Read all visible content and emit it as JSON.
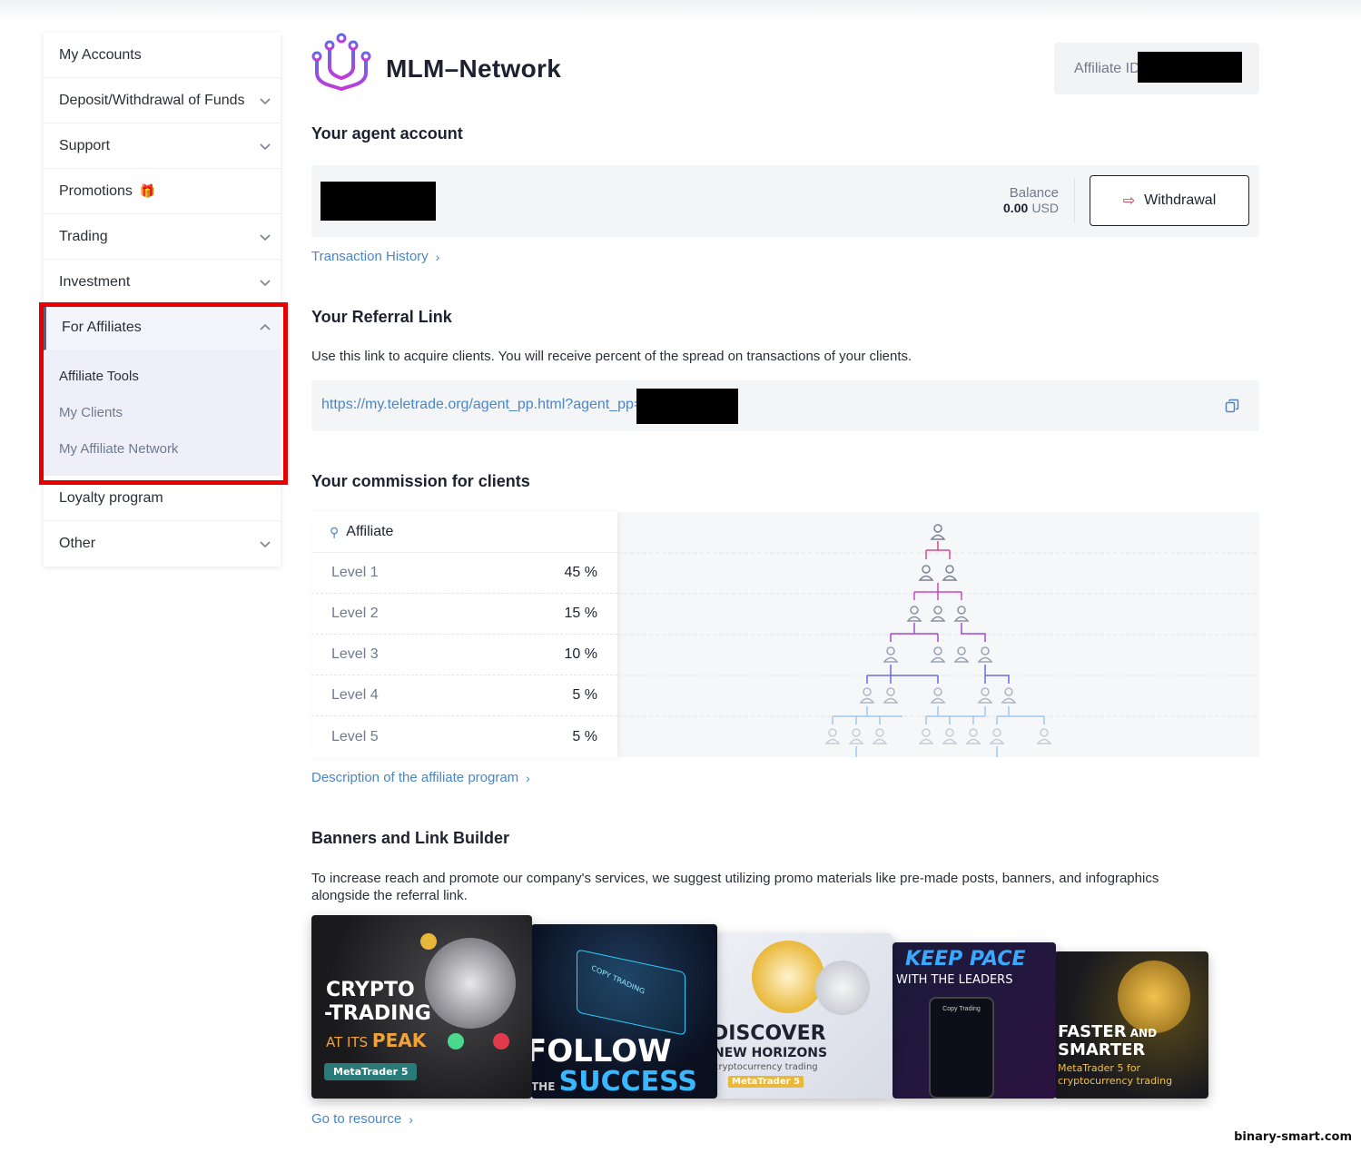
{
  "sidebar": {
    "my_accounts": "My Accounts",
    "deposit": "Deposit/Withdrawal of Funds",
    "support": "Support",
    "promotions": "Promotions",
    "trading": "Trading",
    "investment": "Investment",
    "for_affiliates": "For Affiliates",
    "affiliate_tools": "Affiliate Tools",
    "my_clients": "My Clients",
    "my_affiliate_network": "My Affiliate Network",
    "loyalty": "Loyalty program",
    "other": "Other"
  },
  "header": {
    "title": "MLM–Network",
    "affiliate_id_label": "Affiliate ID"
  },
  "agent": {
    "heading": "Your agent account",
    "balance_label": "Balance",
    "balance_value": "0.00",
    "currency": "USD",
    "withdrawal_label": "Withdrawal",
    "transaction_history": "Transaction History"
  },
  "referral": {
    "heading": "Your Referral Link",
    "description": "Use this link to acquire clients. You will receive percent of the spread on transactions of your clients.",
    "url": "https://my.teletrade.org/agent_pp.html?agent_pp="
  },
  "commission": {
    "heading": "Your commission for clients",
    "affiliate_label": "Affiliate",
    "levels": [
      {
        "level": "Level 1",
        "percent": "45 %"
      },
      {
        "level": "Level 2",
        "percent": "15 %"
      },
      {
        "level": "Level 3",
        "percent": "10 %"
      },
      {
        "level": "Level 4",
        "percent": "5 %"
      },
      {
        "level": "Level 5",
        "percent": "5 %"
      }
    ],
    "description_link": "Description of the affiliate program"
  },
  "banners": {
    "heading": "Banners and Link Builder",
    "description": "To increase reach and promote our company's services, we suggest utilizing promo materials like pre-made posts, banners, and infographics alongside the referral link.",
    "items": [
      {
        "line1": "CRYPTO",
        "line2": "-TRADING",
        "line3a": "AT ITS ",
        "line3b": "PEAK",
        "badge": "MetaTrader 5"
      },
      {
        "line1": "FOLLOW",
        "line2a": "THE ",
        "line2b": "SUCCESS",
        "screen": "COPY TRADING"
      },
      {
        "line1": "DISCOVER",
        "line2": "NEW HORIZONS",
        "line3": "cryptocurrency trading",
        "badge": "MetaTrader 5"
      },
      {
        "line1": "KEEP PACE",
        "line2": "WITH THE LEADERS",
        "screen": "Copy Trading"
      },
      {
        "line1a": "FASTER",
        "line1b": " AND",
        "line2": "SMARTER",
        "line3": "MetaTrader 5 for",
        "line4": "cryptocurrency trading"
      }
    ],
    "go_link": "Go to resource"
  },
  "colors": {
    "accent_blue": "#4a86c8",
    "brand_purple": "#9b3fd8",
    "highlight_red": "#e80000"
  },
  "watermark": "binary-smart.com"
}
